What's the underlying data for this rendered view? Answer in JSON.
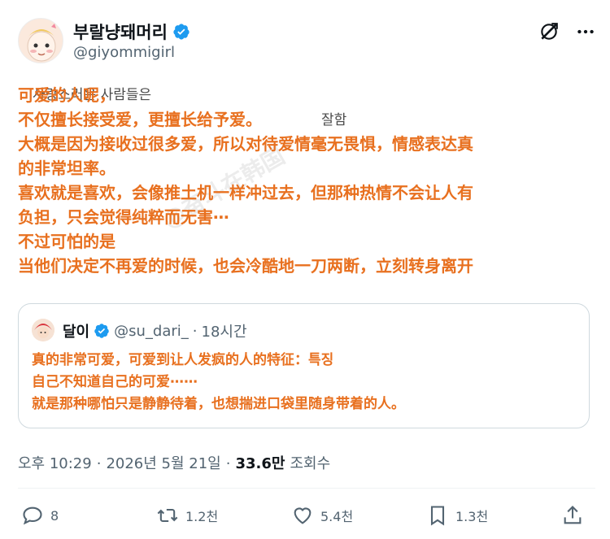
{
  "author": {
    "display_name": "부랄냥돼머리",
    "handle": "@giyommigirl"
  },
  "post": {
    "lines": [
      "可爱的人呢，",
      "不仅擅长接受爱，更擅长给予爱。",
      "大概是因为接收过很多爱，所以对待爱情毫无畏惧，情感表达真",
      "的非常坦率。",
      "喜欢就是喜欢，会像推土机一样冲过去，但那种热情不会让人有",
      "负担，只会觉得纯粹而无害⋯",
      "不过可怕的是",
      "当他们决定不再爱的时候，也会冷酷地一刀两断，立刻转身离开"
    ],
    "underlying_korean_fragments": [
      "사랑스러운 사람들은",
      "잘함",
      "잘"
    ]
  },
  "quote": {
    "display_name": "달이",
    "handle": "@su_dari_",
    "separator": "·",
    "time": "18시간",
    "lines": [
      "真的非常可爱，可爱到让人发疯的人的特征：특징",
      "自己不知道自己的可爱⋯⋯",
      "就是那种哪怕只是静静待着，也想揣进口袋里随身带着的人。"
    ]
  },
  "meta": {
    "time": "오후 10:29",
    "sep1": "·",
    "date": "2026년 5월 21일",
    "sep2": "·",
    "views": "33.6만",
    "views_label": "조회수"
  },
  "actions": {
    "replies": "8",
    "reposts": "1.2천",
    "likes": "5.4천",
    "bookmarks": "1.3천"
  },
  "watermark": "@奋斗在韩国",
  "colors": {
    "translation_text": "#e8701f",
    "verified_blue": "#1d9bf0",
    "secondary_text": "#536471"
  }
}
